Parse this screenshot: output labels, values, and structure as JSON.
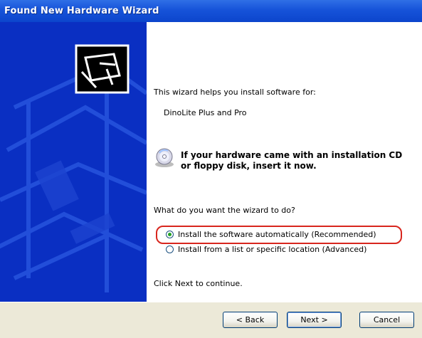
{
  "window": {
    "title": "Found New Hardware Wizard"
  },
  "main": {
    "intro": "This wizard helps you install software for:",
    "device_name": "DinoLite Plus and Pro",
    "cd_prompt_line1": "If your hardware came with an installation CD",
    "cd_prompt_line2": "or floppy disk, insert it now.",
    "question": "What do you want the wizard to do?",
    "options": [
      {
        "label": "Install the software automatically (Recommended)",
        "selected": true
      },
      {
        "label": "Install from a list or specific location (Advanced)",
        "selected": false
      }
    ],
    "continue_hint": "Click Next to continue."
  },
  "buttons": {
    "back": "< Back",
    "next": "Next >",
    "cancel": "Cancel"
  },
  "icons": {
    "wizard_graphic": "hardware-board-icon",
    "cd": "cd-disc-icon"
  },
  "colors": {
    "title_bar": "#1653d9",
    "left_panel": "#0a2fc2",
    "footer": "#ece9d8",
    "highlight_ring": "#d8261e"
  }
}
